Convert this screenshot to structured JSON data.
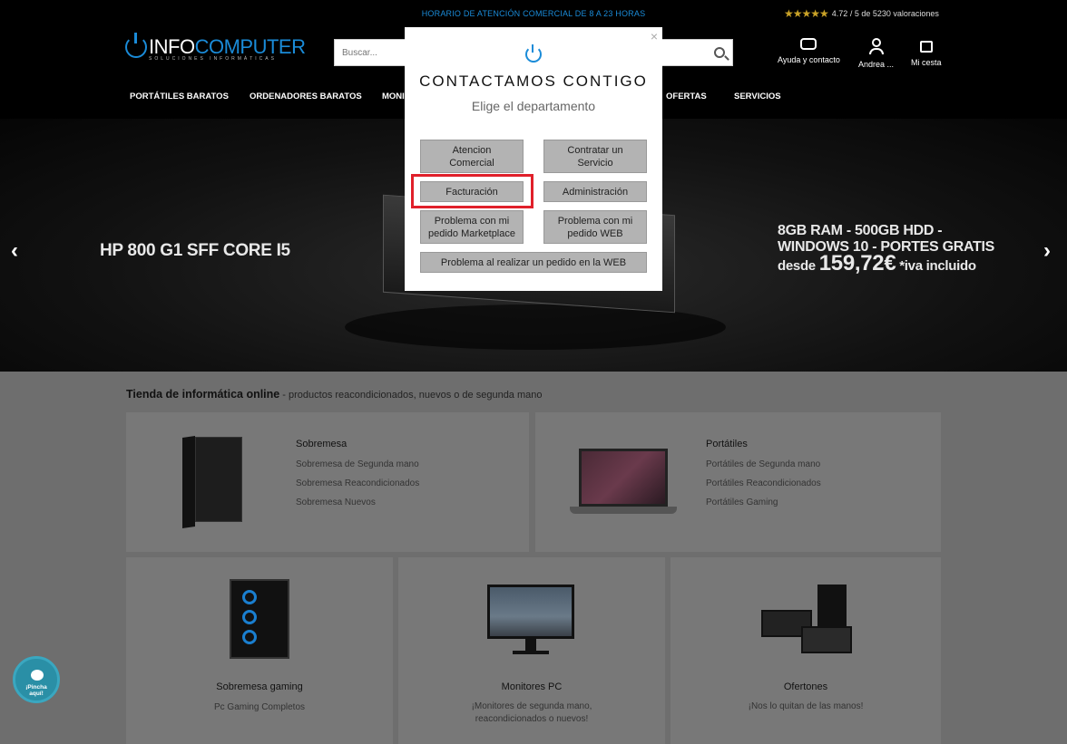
{
  "header": {
    "promo": "HORARIO DE ATENCIÓN COMERCIAL DE 8 A 23 HORAS",
    "rating_stars": "★★★★★",
    "rating_text": "4.72 / 5 de 5230 valoraciones",
    "logo_left": "INFO",
    "logo_right": "COMPUTER",
    "logo_tagline": "SOLUCIONES INFORMÁTICAS",
    "search_placeholder": "Buscar...",
    "help_label": "Ayuda y contacto",
    "account_label": "Andrea ...",
    "cart_label": "Mi cesta"
  },
  "nav": {
    "items": [
      "PORTÁTILES BARATOS",
      "ORDENADORES BARATOS",
      "MONI",
      "OFERTAS",
      "SERVICIOS"
    ]
  },
  "hero": {
    "left_title": "HP 800 G1 SFF CORE I5",
    "right_line1": "8GB RAM - 500GB HDD -",
    "right_line2": "WINDOWS  10 - PORTES GRATIS",
    "price_prefix": "desde ",
    "price": "159,72€",
    "price_suffix": " *iva incluido",
    "prev": "‹",
    "next": "›"
  },
  "content": {
    "heading_bold": "Tienda de informática online",
    "heading_rest": " - productos reacondicionados, nuevos o de segunda mano",
    "cards": [
      {
        "title": "Sobremesa",
        "links": [
          "Sobremesa de Segunda mano",
          "Sobremesa Reacondicionados",
          "Sobremesa Nuevos"
        ]
      },
      {
        "title": "Portátiles",
        "links": [
          "Portátiles de Segunda mano",
          "Portátiles Reacondicionados",
          "Portátiles Gaming"
        ]
      },
      {
        "title": "Sobremesa gaming",
        "desc": "Pc Gaming Completos"
      },
      {
        "title": "Monitores PC",
        "desc1": "¡Monitores de segunda mano,",
        "desc2": "reacondicionados o nuevos!"
      },
      {
        "title": "Ofertones",
        "desc": "¡Nos lo quitan de las manos!"
      }
    ]
  },
  "chat": {
    "line1": "¡Pincha",
    "line2": "aquí!"
  },
  "modal": {
    "close": "×",
    "title": "CONTACTAMOS CONTIGO",
    "subtitle": "Elige el departamento",
    "buttons": {
      "atencion_l1": "Atencion",
      "atencion_l2": "Comercial",
      "contratar_l1": "Contratar un",
      "contratar_l2": "Servicio",
      "facturacion": "Facturación",
      "administracion": "Administración",
      "marketplace_l1": "Problema con mi",
      "marketplace_l2": "pedido Marketplace",
      "web_l1": "Problema con mi",
      "web_l2": "pedido WEB",
      "realizar": "Problema al realizar un pedido en la WEB"
    }
  },
  "colors": {
    "brand": "#1a8bd8",
    "highlight": "#e0202a"
  }
}
